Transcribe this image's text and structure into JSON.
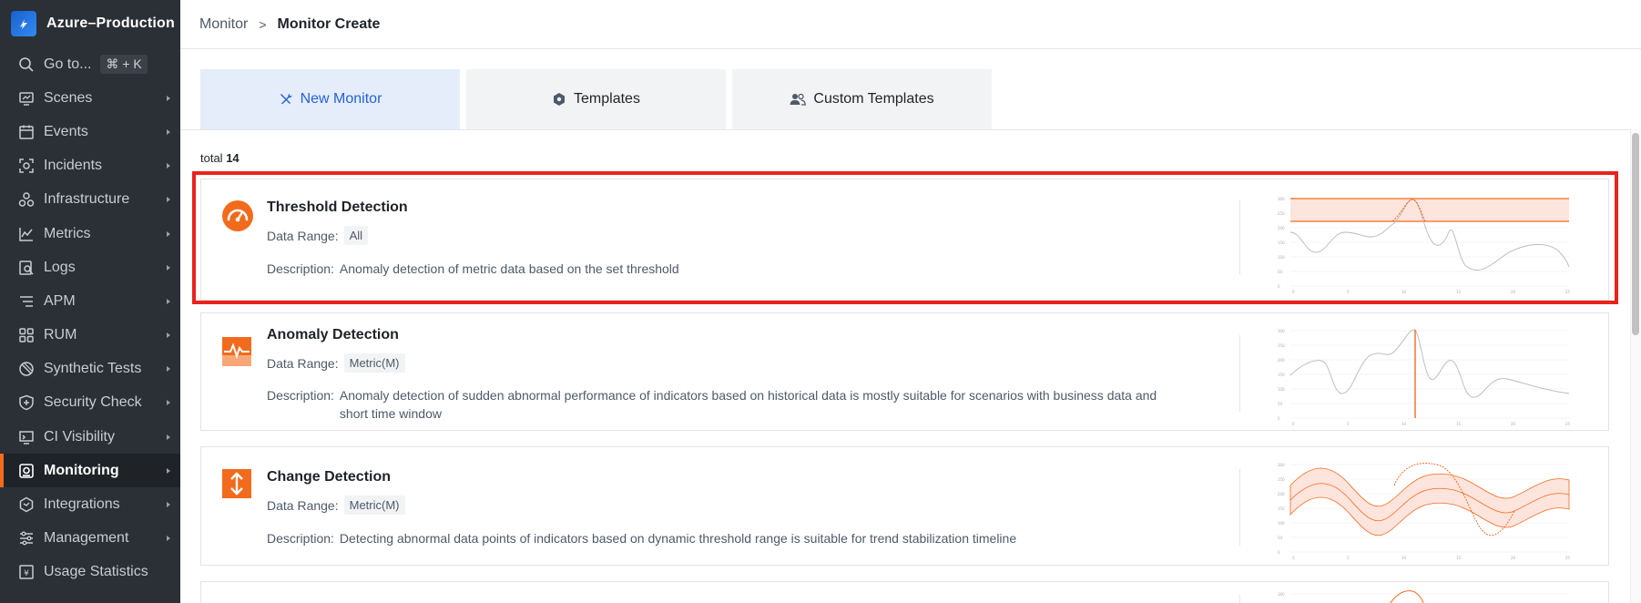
{
  "workspace": {
    "name": "Azure–Production"
  },
  "sidebar": {
    "goto": {
      "label": "Go to...",
      "shortcut": "⌘ + K"
    },
    "items": [
      {
        "label": "Scenes",
        "icon": "monitor-screen-icon"
      },
      {
        "label": "Events",
        "icon": "calendar-icon"
      },
      {
        "label": "Incidents",
        "icon": "incident-icon"
      },
      {
        "label": "Infrastructure",
        "icon": "infrastructure-icon"
      },
      {
        "label": "Metrics",
        "icon": "metrics-chart-icon"
      },
      {
        "label": "Logs",
        "icon": "logs-search-icon"
      },
      {
        "label": "APM",
        "icon": "apm-icon"
      },
      {
        "label": "RUM",
        "icon": "grid-icon"
      },
      {
        "label": "Synthetic Tests",
        "icon": "synthetic-tests-icon"
      },
      {
        "label": "Security Check",
        "icon": "shield-plus-icon"
      },
      {
        "label": "CI Visibility",
        "icon": "ci-icon"
      },
      {
        "label": "Monitoring",
        "icon": "monitoring-icon",
        "active": true
      },
      {
        "label": "Integrations",
        "icon": "integrations-hex-icon"
      },
      {
        "label": "Management",
        "icon": "sliders-icon"
      },
      {
        "label": "Usage Statistics",
        "icon": "usage-statistics-icon"
      }
    ]
  },
  "breadcrumb": {
    "parent": "Monitor",
    "separator": ">",
    "current": "Monitor Create"
  },
  "tabs": [
    {
      "label": "New Monitor",
      "icon": "tools-icon",
      "active": true
    },
    {
      "label": "Templates",
      "icon": "hexagon-icon",
      "active": false
    },
    {
      "label": "Custom Templates",
      "icon": "users-icon",
      "active": false
    }
  ],
  "total": {
    "label": "total",
    "count": "14"
  },
  "range_label": "Data Range:",
  "desc_label": "Description:",
  "cards": [
    {
      "title": "Threshold Detection",
      "range": "All",
      "description": "Anomaly detection of metric data based on the set threshold",
      "icon": "gauge-icon"
    },
    {
      "title": "Anomaly Detection",
      "range": "Metric(M)",
      "description": "Anomaly detection of sudden abnormal performance of indicators based on historical data is mostly suitable for scenarios with business data and short time window",
      "icon": "pulse-icon"
    },
    {
      "title": "Change Detection",
      "range": "Metric(M)",
      "description": "Detecting abnormal data points of indicators based on dynamic threshold range is suitable for trend stabilization timeline",
      "icon": "up-down-arrows-icon"
    }
  ],
  "colors": {
    "accent": "#f26b1d",
    "primary": "#2463d3",
    "sidebar_bg": "#2b2f36",
    "highlight": "#e8231c"
  }
}
